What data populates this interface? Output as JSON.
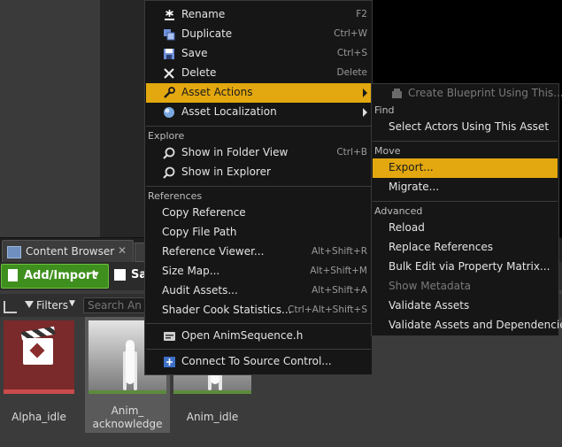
{
  "content_browser": {
    "tab_label": "Content Browser",
    "add_import_label": "Add/Import",
    "save_label": "Sa",
    "filters_label": "Filters",
    "search_placeholder": "Search Anim",
    "assets": [
      {
        "name": "Alpha_idle"
      },
      {
        "name_line1": "Anim_",
        "name_line2": "acknowledge"
      },
      {
        "name": "Anim_idle"
      }
    ]
  },
  "context_menu": {
    "items_top": [
      {
        "icon": "rename-icon",
        "label": "Rename",
        "shortcut": "F2"
      },
      {
        "icon": "duplicate-icon",
        "label": "Duplicate",
        "shortcut": "Ctrl+W"
      },
      {
        "icon": "save-icon",
        "label": "Save",
        "shortcut": "Ctrl+S"
      },
      {
        "icon": "delete-icon",
        "label": "Delete",
        "shortcut": "Delete"
      },
      {
        "icon": "wrench-icon",
        "label": "Asset Actions",
        "highlighted": true
      },
      {
        "icon": "globe-icon",
        "label": "Asset Localization"
      }
    ],
    "explore_header": "Explore",
    "explore_items": [
      {
        "icon": "magnifier-icon",
        "label": "Show in Folder View",
        "shortcut": "Ctrl+B"
      },
      {
        "icon": "magnifier-icon",
        "label": "Show in Explorer"
      }
    ],
    "references_header": "References",
    "references_items": [
      {
        "label": "Copy Reference"
      },
      {
        "label": "Copy File Path"
      },
      {
        "label": "Reference Viewer...",
        "shortcut": "Alt+Shift+R"
      },
      {
        "label": "Size Map...",
        "shortcut": "Alt+Shift+M"
      },
      {
        "label": "Audit Assets...",
        "shortcut": "Alt+Shift+A"
      },
      {
        "label": "Shader Cook Statistics...",
        "shortcut": "Ctrl+Alt+Shift+S"
      }
    ],
    "open_source": {
      "icon": "code-file-icon",
      "label": "Open AnimSequence.h"
    },
    "source_control": {
      "icon": "source-control-icon",
      "label": "Connect To Source Control..."
    }
  },
  "asset_actions_submenu": {
    "create_blueprint": "Create Blueprint Using This...",
    "find_header": "Find",
    "select_actors": "Select Actors Using This Asset",
    "move_header": "Move",
    "export": "Export...",
    "migrate": "Migrate...",
    "advanced_header": "Advanced",
    "reload": "Reload",
    "replace_references": "Replace References",
    "bulk_edit": "Bulk Edit via Property Matrix...",
    "show_metadata": "Show Metadata",
    "validate_assets": "Validate Assets",
    "validate_deps": "Validate Assets and Dependencies"
  },
  "colors": {
    "highlight": "#e3a80f",
    "add_button": "#3f8f1e",
    "menu_bg": "#161616"
  }
}
